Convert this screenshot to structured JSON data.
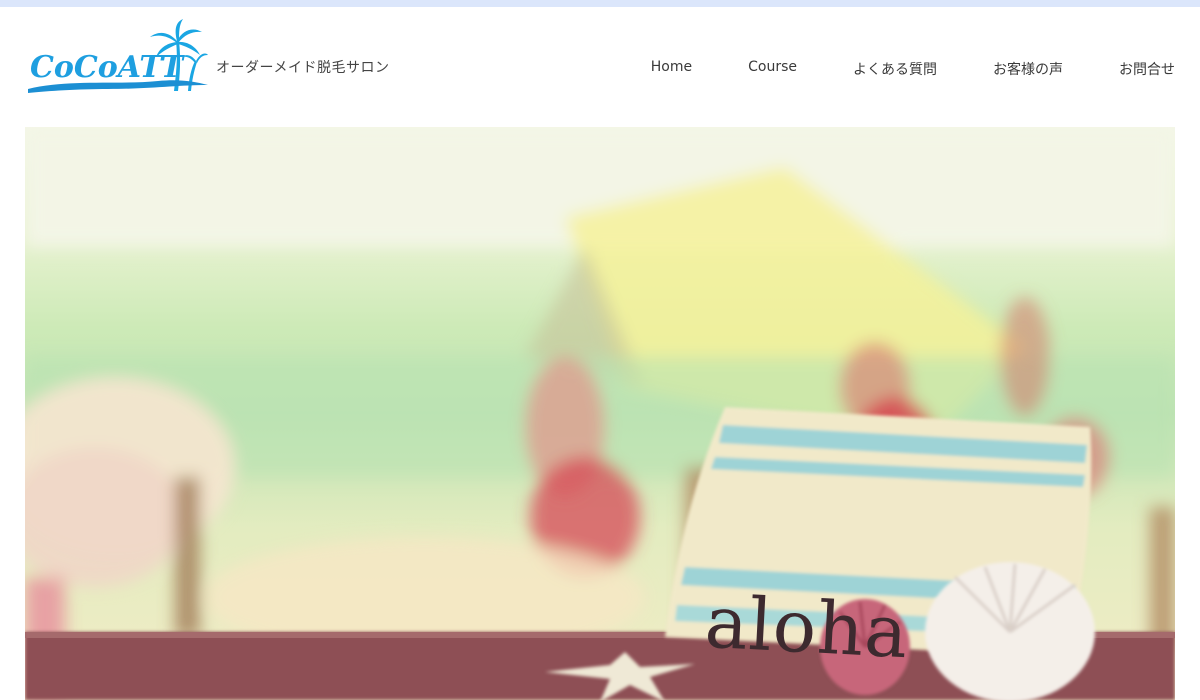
{
  "header": {
    "logo_text": "CoCoATT",
    "tagline": "オーダーメイド脱毛サロン"
  },
  "nav": {
    "items": [
      {
        "label": "Home"
      },
      {
        "label": "Course"
      },
      {
        "label": "よくある質問"
      },
      {
        "label": "お客様の声"
      },
      {
        "label": "お問合せ"
      }
    ]
  },
  "hero": {
    "caption": "aloha",
    "icon": "beach-scene-image"
  },
  "colors": {
    "accent": "#1e9fe0",
    "top_strip": "#dbe6fb"
  }
}
